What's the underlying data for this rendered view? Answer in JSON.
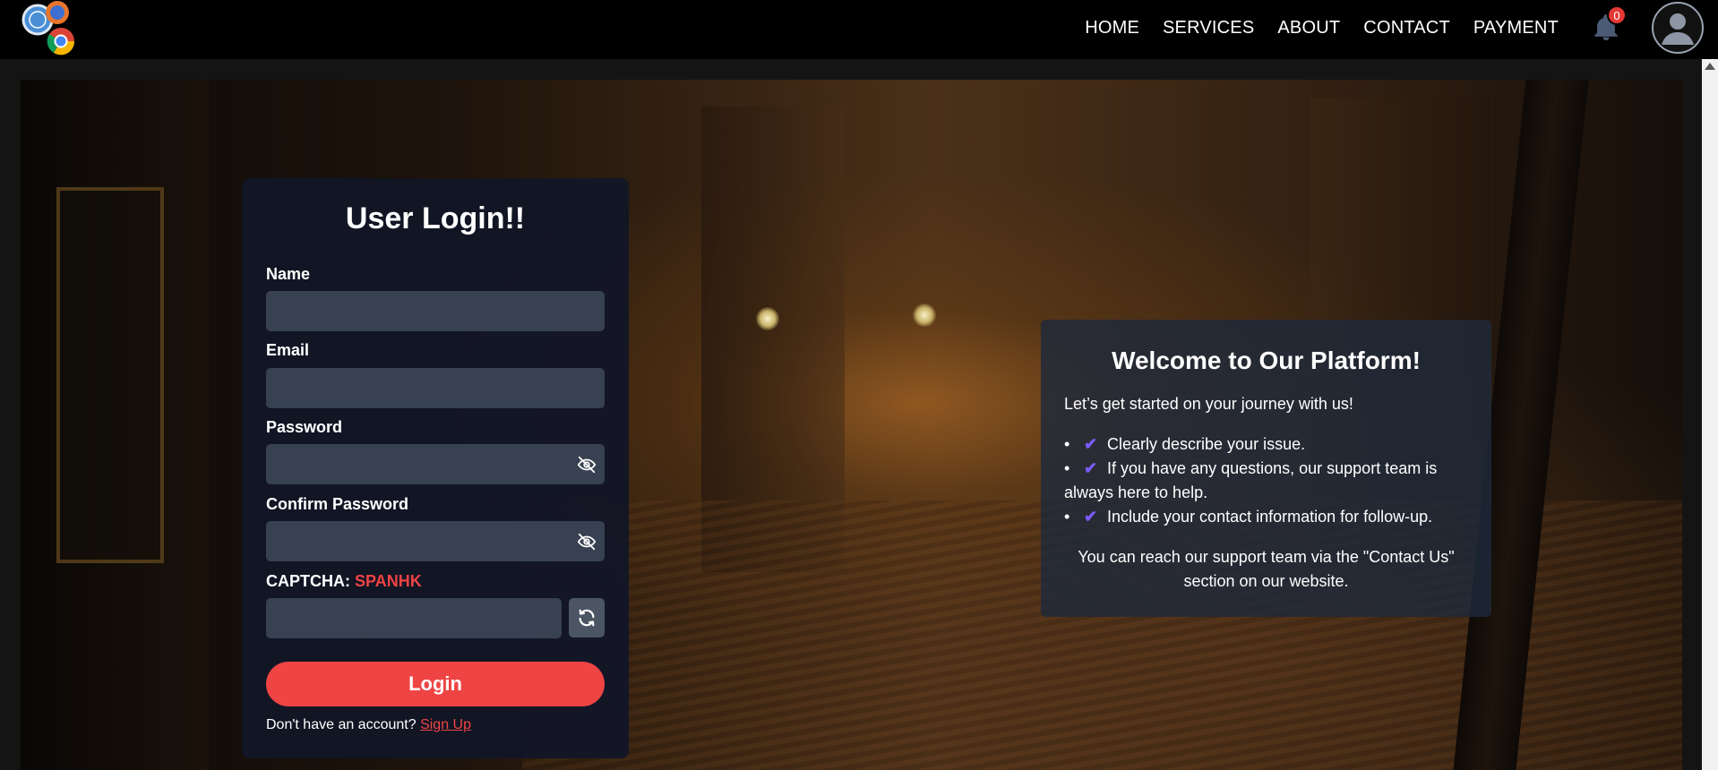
{
  "nav": {
    "links": [
      "HOME",
      "SERVICES",
      "ABOUT",
      "CONTACT",
      "PAYMENT"
    ],
    "notification_count": "0"
  },
  "login": {
    "title": "User Login!!",
    "name_label": "Name",
    "email_label": "Email",
    "password_label": "Password",
    "confirm_label": "Confirm Password",
    "captcha_label": "CAPTCHA:",
    "captcha_code": "SPANHK",
    "button": "Login",
    "signup_prompt": "Don't have an account?",
    "signup_link": "Sign Up"
  },
  "welcome": {
    "title": "Welcome to Our Platform!",
    "subtitle": "Let’s get started on your journey with us!",
    "items": [
      "Clearly describe your issue.",
      "If you have any questions, our support team is always here to help.",
      "Include your contact information for follow-up."
    ],
    "footer": "You can reach our support team via the \"Contact Us\" section on our website."
  },
  "colors": {
    "accent": "#ef4444",
    "check": "#7c5cff",
    "input_bg": "#374151"
  }
}
